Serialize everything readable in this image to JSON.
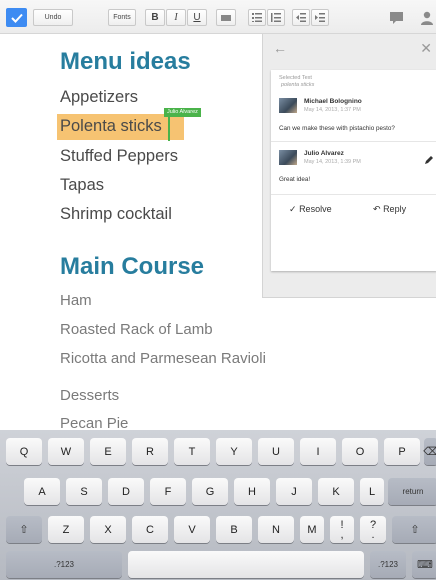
{
  "toolbar": {
    "undo": "Undo",
    "fonts": "Fonts",
    "bold": "B",
    "italic": "I",
    "underline": "U"
  },
  "document": {
    "heading1": "Menu ideas",
    "items1": [
      "Appetizers",
      "Polenta sticks",
      "Stuffed Peppers",
      "Tapas",
      "Shrimp cocktail"
    ],
    "heading2": "Main Course",
    "items2": [
      "Ham",
      "Roasted Rack of Lamb",
      "Ricotta and Parmesean Ravioli",
      "Desserts",
      "Pecan Pie"
    ],
    "collaborator_tag": "Julio Alvarez",
    "highlight_color": "#f6c372",
    "heading_color": "#277d9e"
  },
  "comments": {
    "selected_label": "Selected Text",
    "selected_text": "polenta sticks",
    "thread": [
      {
        "author": "Michael Bolognino",
        "date": "May 14, 2013, 1:37 PM",
        "text": "Can we make these with pistachio pesto?"
      },
      {
        "author": "Julio Alvarez",
        "date": "May 14, 2013, 1:39 PM",
        "text": "Great idea!"
      }
    ],
    "resolve": "Resolve",
    "reply": "Reply"
  },
  "keyboard": {
    "row1": [
      "Q",
      "W",
      "E",
      "R",
      "T",
      "Y",
      "U",
      "I",
      "O",
      "P"
    ],
    "row2": [
      "A",
      "S",
      "D",
      "F",
      "G",
      "H",
      "J",
      "K",
      "L"
    ],
    "return_label": "return",
    "row3": [
      "Z",
      "X",
      "C",
      "V",
      "B",
      "N",
      "M",
      "!",
      ",",
      "?",
      "."
    ],
    "numbers_label": ".?123"
  }
}
